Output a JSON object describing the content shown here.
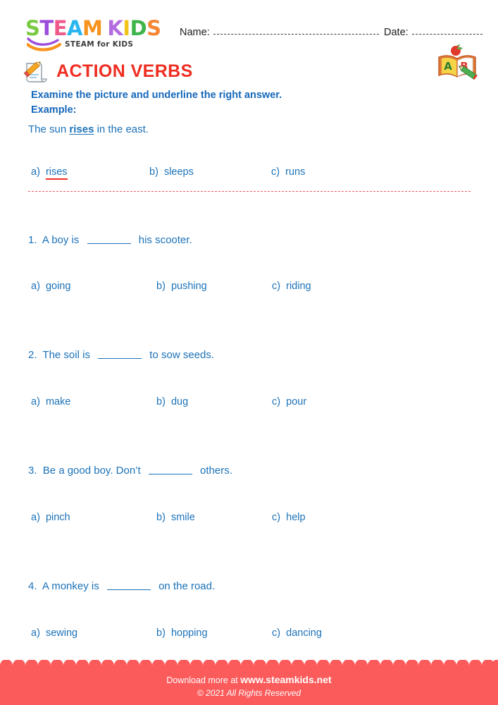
{
  "brand": {
    "logo_letters": [
      {
        "char": "S",
        "color": "#7ac943"
      },
      {
        "char": "T",
        "color": "#9b4ddb"
      },
      {
        "char": "E",
        "color": "#ef5b8a"
      },
      {
        "char": "A",
        "color": "#2bb6ef"
      },
      {
        "char": "M",
        "color": "#f7931e"
      },
      {
        "char": "K",
        "color": "#b36ce0"
      },
      {
        "char": "I",
        "color": "#f2c318"
      },
      {
        "char": "D",
        "color": "#3eb44a"
      },
      {
        "char": "S",
        "color": "#f58634"
      }
    ],
    "logo_word_1": "STEAM",
    "logo_word_2": "KIDS",
    "tagline": "STEAM for KIDS"
  },
  "header": {
    "name_label": "Name:",
    "name_value": "",
    "date_label": "Date:",
    "date_value": "",
    "abc_book_letters": [
      "A",
      "B"
    ]
  },
  "title": {
    "text": "ACTION VERBS",
    "color": "#ef2d21",
    "icon": "pencil-note-icon"
  },
  "instructions": {
    "line1": "Examine the picture and underline the right answer.",
    "line2": "Example:",
    "color": "#1668ba"
  },
  "example": {
    "sentence_before": "The sun ",
    "sentence_answer": "rises",
    "sentence_after": " in the east.",
    "options": [
      {
        "label": "a)",
        "text": "rises",
        "underlined": true
      },
      {
        "label": "b)",
        "text": "sleeps",
        "underlined": false
      },
      {
        "label": "c)",
        "text": "runs",
        "underlined": false
      }
    ]
  },
  "questions": [
    {
      "number": "1.",
      "text_before": "A boy is",
      "text_after": "his scooter.",
      "options": [
        {
          "label": "a)",
          "text": "going"
        },
        {
          "label": "b)",
          "text": "pushing"
        },
        {
          "label": "c)",
          "text": "riding"
        }
      ]
    },
    {
      "number": "2.",
      "text_before": "The soil is",
      "text_after": "to sow seeds.",
      "options": [
        {
          "label": "a)",
          "text": "make"
        },
        {
          "label": "b)",
          "text": "dug"
        },
        {
          "label": "c)",
          "text": "pour"
        }
      ]
    },
    {
      "number": "3.",
      "text_before": "Be a good boy. Don’t",
      "text_after": "others.",
      "options": [
        {
          "label": "a)",
          "text": "pinch"
        },
        {
          "label": "b)",
          "text": "smile"
        },
        {
          "label": "c)",
          "text": "help"
        }
      ]
    },
    {
      "number": "4.",
      "text_before": "A monkey is",
      "text_after": "on the road.",
      "options": [
        {
          "label": "a)",
          "text": "sewing"
        },
        {
          "label": "b)",
          "text": "hopping"
        },
        {
          "label": "c)",
          "text": "dancing"
        }
      ]
    }
  ],
  "footer": {
    "download_text": "Download more at",
    "site": "www.steamkids.net",
    "copyright": "© 2021 All Rights Reserved",
    "background": "#fb5b5b"
  }
}
